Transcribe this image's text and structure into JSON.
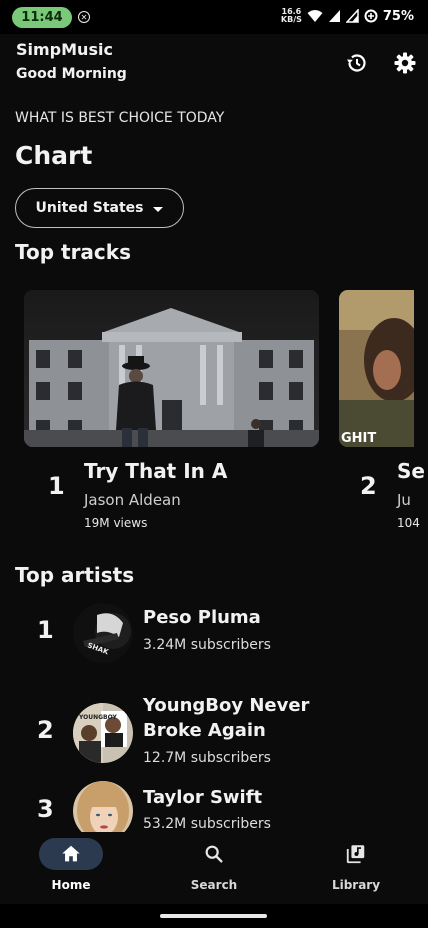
{
  "status_bar": {
    "time": "11:44",
    "net_speed_value": "16.6",
    "net_speed_unit": "KB/S",
    "battery": "75%"
  },
  "header": {
    "app_title": "SimpMusic",
    "greeting": "Good Morning",
    "history_icon": "history-icon",
    "settings_icon": "gear-icon"
  },
  "subtitle": "WHAT IS BEST CHOICE TODAY",
  "chart_title": "Chart",
  "country_selector": {
    "value": "United States"
  },
  "top_tracks": {
    "title": "Top tracks",
    "items": [
      {
        "rank": "1",
        "title": "Try That In A",
        "artist": "Jason Aldean",
        "views": "19M views"
      },
      {
        "rank": "2",
        "title": "Se",
        "artist": "Ju",
        "views": "104",
        "thumb_text": "GHIT"
      }
    ]
  },
  "top_artists": {
    "title": "Top artists",
    "items": [
      {
        "rank": "1",
        "name": "Peso Pluma",
        "subscribers": "3.24M subscribers"
      },
      {
        "rank": "2",
        "name": "YoungBoy Never Broke Again",
        "subscribers": "12.7M subscribers"
      },
      {
        "rank": "3",
        "name": "Taylor Swift",
        "subscribers": "53.2M subscribers"
      }
    ]
  },
  "bottom_nav": {
    "items": [
      {
        "label": "Home",
        "icon": "home-icon",
        "active": true
      },
      {
        "label": "Search",
        "icon": "search-icon",
        "active": false
      },
      {
        "label": "Library",
        "icon": "library-icon",
        "active": false
      }
    ]
  },
  "colors": {
    "background": "#0b0b0b",
    "time_pill": "#79c978",
    "nav_active_pill": "#2c3a4f"
  }
}
